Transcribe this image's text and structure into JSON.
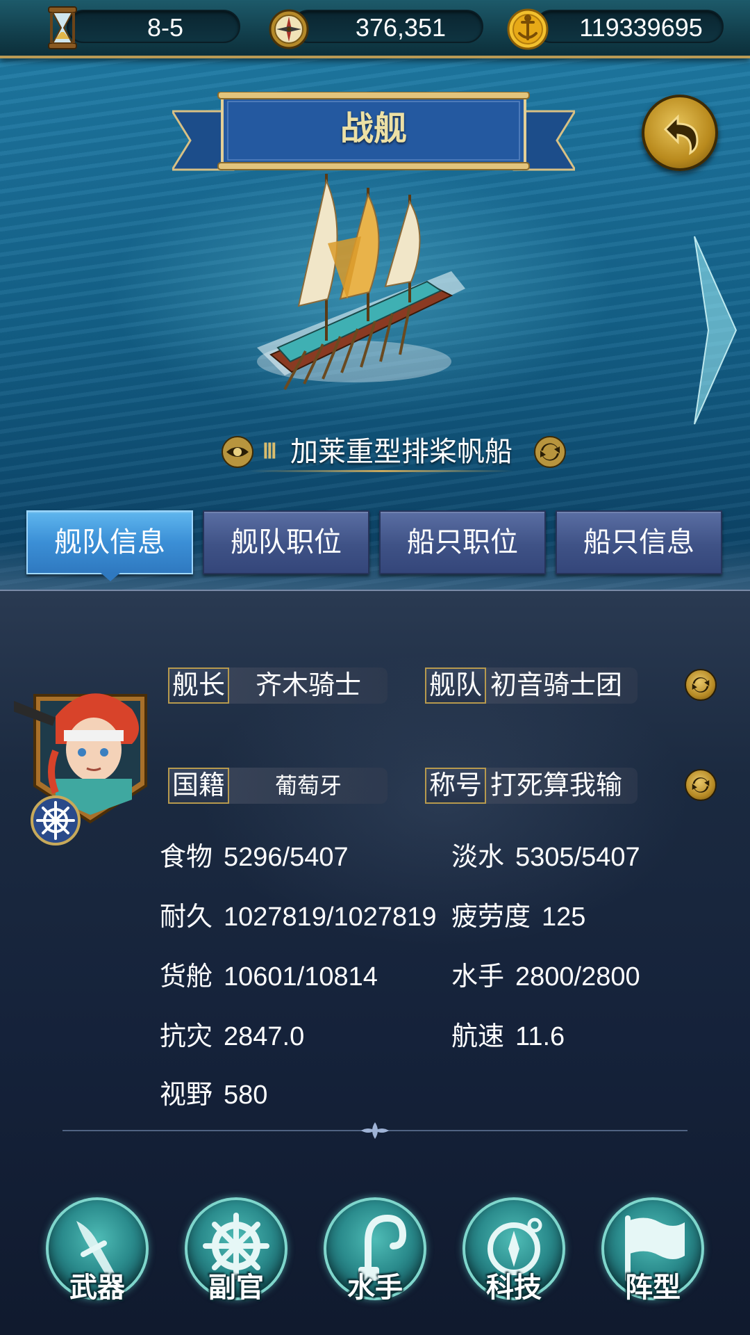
{
  "topbar": {
    "resources": [
      {
        "icon": "hourglass-icon",
        "value": "8-5"
      },
      {
        "icon": "compass-icon",
        "value": "376,351"
      },
      {
        "icon": "gold-coin-icon",
        "value": "119339695"
      }
    ]
  },
  "header": {
    "title": "战舰",
    "back_icon": "back-arrow-icon",
    "next_icon": "next-arrow-icon"
  },
  "ship": {
    "tier": "Ⅲ",
    "name": "加莱重型排桨帆船",
    "view_icon": "eye-icon",
    "switch_icon": "refresh-icon"
  },
  "tabs": [
    {
      "label": "舰队信息",
      "active": true
    },
    {
      "label": "舰队职位",
      "active": false
    },
    {
      "label": "船只职位",
      "active": false
    },
    {
      "label": "船只信息",
      "active": false
    }
  ],
  "captain": {
    "captain_label": "舰长",
    "captain_value": "齐木骑士",
    "fleet_label": "舰队",
    "fleet_value": "初音骑士团",
    "nationality_label": "国籍",
    "nationality_value": "葡萄牙",
    "title_label": "称号",
    "title_value": "打死算我输"
  },
  "stats": {
    "food": {
      "label": "食物",
      "value": "5296/5407"
    },
    "water": {
      "label": "淡水",
      "value": "5305/5407"
    },
    "durability": {
      "label": "耐久",
      "value": "1027819/1027819"
    },
    "fatigue": {
      "label": "疲劳度",
      "value": "125"
    },
    "cargo": {
      "label": "货舱",
      "value": "10601/10814"
    },
    "sailors": {
      "label": "水手",
      "value": "2800/2800"
    },
    "resist": {
      "label": "抗灾",
      "value": "2847.0"
    },
    "speed": {
      "label": "航速",
      "value": "11.6"
    },
    "vision": {
      "label": "视野",
      "value": "580"
    }
  },
  "bottom_buttons": [
    {
      "label": "武器",
      "icon": "sword-icon"
    },
    {
      "label": "副官",
      "icon": "ship-wheel-icon"
    },
    {
      "label": "水手",
      "icon": "hook-icon"
    },
    {
      "label": "科技",
      "icon": "compass-icon"
    },
    {
      "label": "阵型",
      "icon": "flag-icon"
    }
  ],
  "colors": {
    "accent_gold": "#c9a95e",
    "tab_active": "#3b8fd6",
    "tab_inactive": "#3f5286",
    "button_teal": "#2b8c8d"
  }
}
